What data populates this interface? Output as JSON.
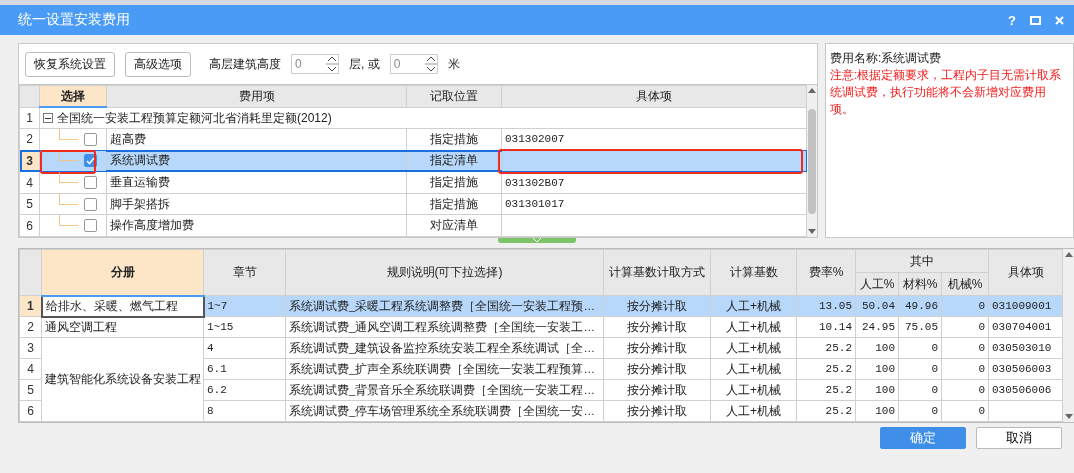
{
  "window": {
    "title": "统一设置安装费用",
    "help": "?"
  },
  "toolbar": {
    "buttons": [
      "恢复系统设置",
      "高级选项"
    ],
    "height_label": "高层建筑高度",
    "floors_value": "0",
    "or_label": "层, 或",
    "meters_value": "0",
    "unit_label": "米"
  },
  "fee_table": {
    "columns": [
      {
        "label": "选择",
        "selected": true
      },
      {
        "label": "费用项",
        "selected": false
      },
      {
        "label": "记取位置",
        "selected": false
      },
      {
        "label": "具体项",
        "selected": false
      }
    ],
    "rows": [
      {
        "number": "1",
        "kind": "group",
        "label": "全国统一安装工程预算定额河北省消耗里定额(2012)",
        "expanded": true,
        "selected": false
      },
      {
        "number": "2",
        "kind": "item",
        "checked": false,
        "selected": false,
        "annotated": false,
        "name": "超高费",
        "position": "指定措施",
        "item": "031302007"
      },
      {
        "number": "3",
        "kind": "item",
        "checked": true,
        "selected": true,
        "annotated": true,
        "name": "系统调试费",
        "position": "指定清单"
      },
      {
        "number": "4",
        "kind": "item",
        "checked": false,
        "selected": false,
        "annotated": false,
        "name": "垂直运输费",
        "position": "指定措施",
        "item": "031302B07"
      },
      {
        "number": "5",
        "kind": "item",
        "checked": false,
        "selected": false,
        "annotated": false,
        "name": "脚手架搭拆",
        "position": "指定措施",
        "item": "031301017"
      },
      {
        "number": "6",
        "kind": "item",
        "checked": false,
        "selected": false,
        "annotated": false,
        "name": "操作高度增加费",
        "position": "对应清单"
      }
    ]
  },
  "info_panel": {
    "fee_name": "费用名称:系统调试费",
    "note": "注意:根据定额要求，工程内子目无需计取系统调试费，执行功能将不会新增对应费用项。"
  },
  "rule_table": {
    "columns": [
      {
        "label": "分册",
        "selected": true
      },
      {
        "label": "章节",
        "selected": false
      },
      {
        "label": "规则说明(可下拉选择)",
        "selected": false
      },
      {
        "label": "计算基数计取方式",
        "selected": false
      },
      {
        "label": "计算基数",
        "selected": false
      },
      {
        "label": "费率%",
        "selected": false
      },
      {
        "label": "其中",
        "selected": false,
        "children": [
          "人工%",
          "材料%",
          "机械%"
        ]
      },
      {
        "label": "具体项",
        "selected": false
      }
    ],
    "volumes": [
      {
        "name": "给排水、采暖、燃气工程",
        "rows": [
          {
            "number": "1",
            "selected": true,
            "chapter": "1~7",
            "rule": "系统调试费_采暖工程系统调整费［全国统一安装工程预…",
            "method": "按分摊计取",
            "base": "人工+机械",
            "rate": "13.05",
            "labor": "50.04",
            "material": "49.96",
            "machine": "0",
            "item": "031009001"
          }
        ]
      },
      {
        "name": "通风空调工程",
        "rows": [
          {
            "number": "2",
            "selected": false,
            "chapter": "1~15",
            "rule": "系统调试费_通风空调工程系统调整费［全国统一安装工…",
            "method": "按分摊计取",
            "base": "人工+机械",
            "rate": "10.14",
            "labor": "24.95",
            "material": "75.05",
            "machine": "0",
            "item": "030704001"
          }
        ]
      },
      {
        "name": "建筑智能化系统设备安装工程",
        "rows": [
          {
            "number": "3",
            "selected": false,
            "chapter": "4",
            "rule": "系统调试费_建筑设备监控系统安装工程全系统调试［全…",
            "method": "按分摊计取",
            "base": "人工+机械",
            "rate": "25.2",
            "labor": "100",
            "material": "0",
            "machine": "0",
            "item": "030503010"
          },
          {
            "number": "4",
            "selected": false,
            "chapter": "6.1",
            "rule": "系统调试费_扩声全系统联调费［全国统一安装工程预算…",
            "method": "按分摊计取",
            "base": "人工+机械",
            "rate": "25.2",
            "labor": "100",
            "material": "0",
            "machine": "0",
            "item": "030506003"
          },
          {
            "number": "5",
            "selected": false,
            "chapter": "6.2",
            "rule": "系统调试费_背景音乐全系统联调费［全国统一安装工程…",
            "method": "按分摊计取",
            "base": "人工+机械",
            "rate": "25.2",
            "labor": "100",
            "material": "0",
            "machine": "0",
            "item": "030506006"
          },
          {
            "number": "6",
            "selected": false,
            "chapter": "8",
            "rule": "系统调试费_停车场管理系统全系统联调费［全国统一安…",
            "method": "按分摊计取",
            "base": "人工+机械",
            "rate": "25.2",
            "labor": "100",
            "material": "0",
            "machine": "0"
          }
        ]
      }
    ]
  },
  "footer": {
    "buttons": [
      {
        "label": "确定",
        "kind": "primary"
      },
      {
        "label": "取消",
        "kind": "default"
      }
    ]
  }
}
